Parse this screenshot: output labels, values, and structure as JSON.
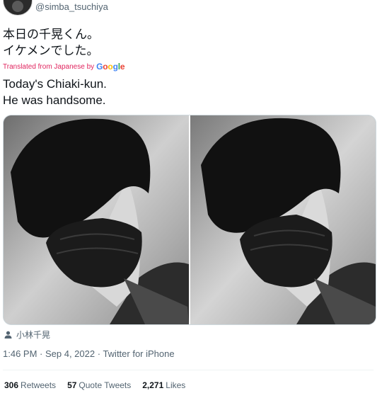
{
  "tweet": {
    "handle": "@simba_tsuchiya",
    "original_lines": [
      "本日の千晃くん。",
      "イケメンでした。"
    ],
    "translated_prefix": "Translated from Japanese by",
    "translated_brand": "Google",
    "translation_lines": [
      "Today's Chiaki-kun.",
      "He was handsome."
    ],
    "tagged_user": "小林千晃",
    "timestamp": "1:46 PM · Sep 4, 2022",
    "source": "Twitter for iPhone",
    "stats": {
      "retweets_count": "306",
      "retweets_label": "Retweets",
      "quotes_count": "57",
      "quotes_label": "Quote Tweets",
      "likes_count": "2,271",
      "likes_label": "Likes"
    }
  },
  "icons": {
    "avatar": "avatar",
    "tag": "person-icon"
  },
  "colors": {
    "translated_link": "#e0245e",
    "secondary_text": "#536471",
    "primary_text": "#0f1419"
  }
}
